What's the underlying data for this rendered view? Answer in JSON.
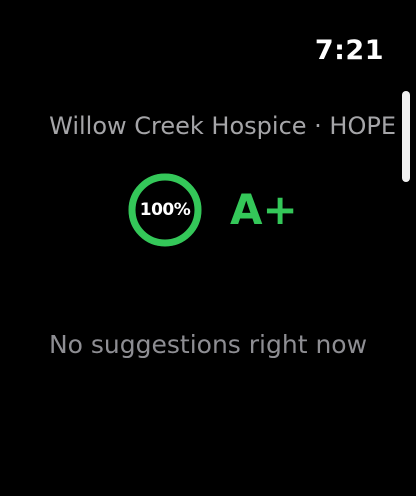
{
  "status_bar": {
    "time": "7:21"
  },
  "header": {
    "location_title": "Willow Creek Hospice · HOPE"
  },
  "score": {
    "percent_label": "100%",
    "fraction": 1.0,
    "grade": "A+",
    "ring_color": "#34c759"
  },
  "suggestions": {
    "empty_message": "No suggestions right now"
  },
  "colors": {
    "background": "#000000",
    "accent_green": "#34c759",
    "secondary_text": "#8e8e93"
  }
}
